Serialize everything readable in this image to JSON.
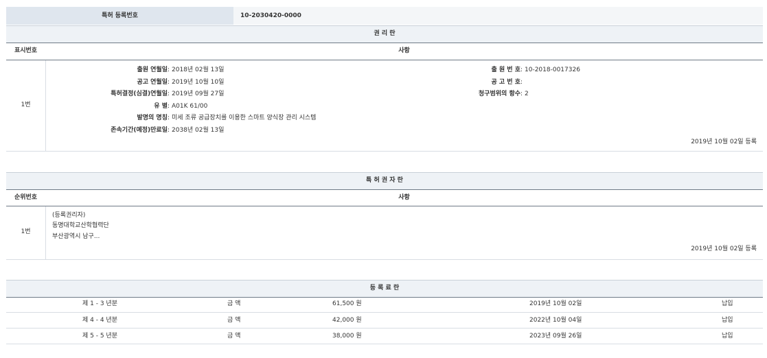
{
  "reg": {
    "label": "특허 등록번호",
    "value": "10-2030420-0000"
  },
  "rights": {
    "title": "권 리 란",
    "col_no": "표시번호",
    "col_item": "사항",
    "row_no": "1번",
    "left": [
      {
        "k": "출원 연월일",
        "v": "2018년 02월 13일"
      },
      {
        "k": "공고 연월일",
        "v": "2019년 10월 10일"
      },
      {
        "k": "특허결정(심결)연월일",
        "v": "2019년 09월 27일"
      },
      {
        "k": "유 별",
        "v": "A01K 61/00"
      },
      {
        "k": "발명의 명칭",
        "v": "미세 조류 공급장치를 이용한 스마트 양식장 관리 시스템"
      },
      {
        "k": "존속기간(예정)만료일",
        "v": "2038년 02월 13일"
      }
    ],
    "right": [
      {
        "k": "출 원 번 호",
        "v": "10-2018-0017326"
      },
      {
        "k": "공 고 번 호",
        "v": ""
      },
      {
        "k": "청구범위의 항수",
        "v": "2"
      }
    ],
    "date_note": "2019년 10월 02일 등록"
  },
  "owner": {
    "title": "특 허 권 자 란",
    "col_no": "순위번호",
    "col_item": "사항",
    "row_no": "1번",
    "lines": [
      "(등록권리자)",
      "동명대학교산학협력단",
      "부산광역시 남구..."
    ],
    "date_note": "2019년 10월 02일 등록"
  },
  "fee": {
    "title": "등 록 료 란",
    "rows": [
      {
        "period": "제 1 - 3 년분",
        "label": "금 액",
        "amount": "61,500 원",
        "date": "2019년 10월 02일",
        "status": "납입"
      },
      {
        "period": "제 4 - 4 년분",
        "label": "금 액",
        "amount": "42,000 원",
        "date": "2022년 10월 04일",
        "status": "납입"
      },
      {
        "period": "제 5 - 5 년분",
        "label": "금 액",
        "amount": "38,000 원",
        "date": "2023년 09월 26일",
        "status": "납입"
      }
    ]
  }
}
